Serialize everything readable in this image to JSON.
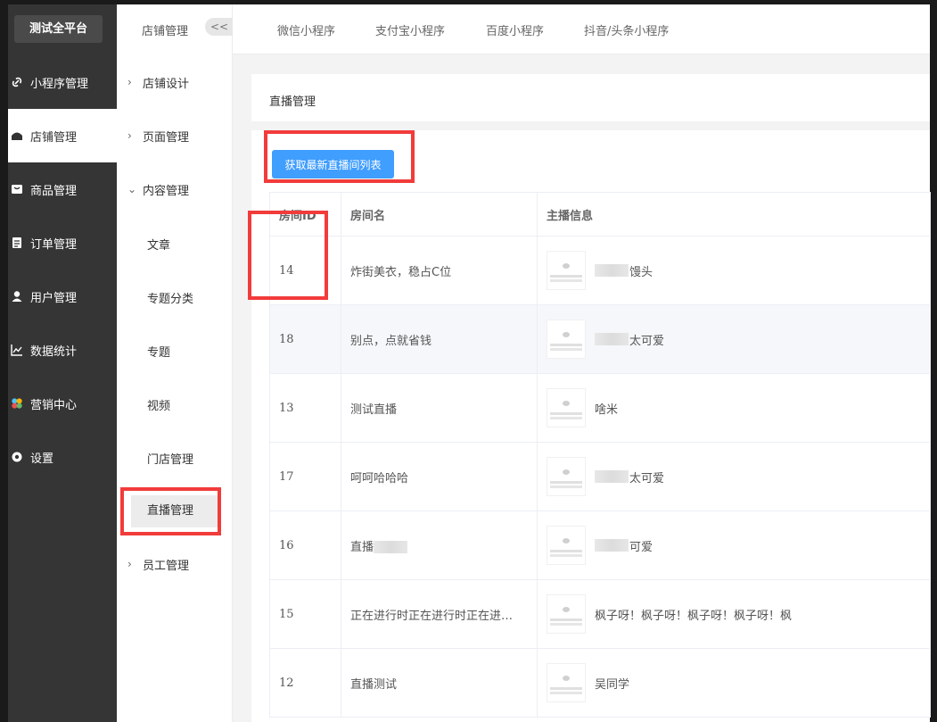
{
  "brand": "测试全平台",
  "nav": [
    {
      "label": "小程序管理",
      "icon": "link-icon"
    },
    {
      "label": "店铺管理",
      "icon": "store-icon"
    },
    {
      "label": "商品管理",
      "icon": "bag-icon"
    },
    {
      "label": "订单管理",
      "icon": "clipboard-icon"
    },
    {
      "label": "用户管理",
      "icon": "user-icon"
    },
    {
      "label": "数据统计",
      "icon": "chart-icon"
    },
    {
      "label": "营销中心",
      "icon": "marketing-icon"
    },
    {
      "label": "设置",
      "icon": "gear-icon"
    }
  ],
  "subside": {
    "title": "店铺管理",
    "collapse": "<<",
    "items": [
      "店铺设计",
      "页面管理",
      "内容管理",
      "员工管理"
    ],
    "content_children": [
      "文章",
      "专题分类",
      "专题",
      "视频",
      "门店管理",
      "直播管理"
    ]
  },
  "tabs": [
    "微信小程序",
    "支付宝小程序",
    "百度小程序",
    "抖音/头条小程序"
  ],
  "panel": {
    "title": "直播管理",
    "fetch_button": "获取最新直播间列表"
  },
  "table": {
    "headers": [
      "房间ID",
      "房间名",
      "主播信息"
    ],
    "rows": [
      {
        "id": "14",
        "name": "炸街美衣，稳占C位",
        "anchor": "馒头"
      },
      {
        "id": "18",
        "name": "别点，点就省钱",
        "anchor": "太可爱"
      },
      {
        "id": "13",
        "name": "测试直播",
        "anchor": "啥米"
      },
      {
        "id": "17",
        "name": "呵呵哈哈哈",
        "anchor": "太可爱"
      },
      {
        "id": "16",
        "name": "直播",
        "anchor": "可爱"
      },
      {
        "id": "15",
        "name": "正在进行时正在进行时正在进…",
        "anchor": "枫子呀！枫子呀！枫子呀！枫子呀！枫"
      },
      {
        "id": "12",
        "name": "直播测试",
        "anchor": "吴同学"
      }
    ]
  },
  "colors": {
    "primary": "#409eff",
    "sidebar": "#353535",
    "annotation": "#f23b3b"
  }
}
